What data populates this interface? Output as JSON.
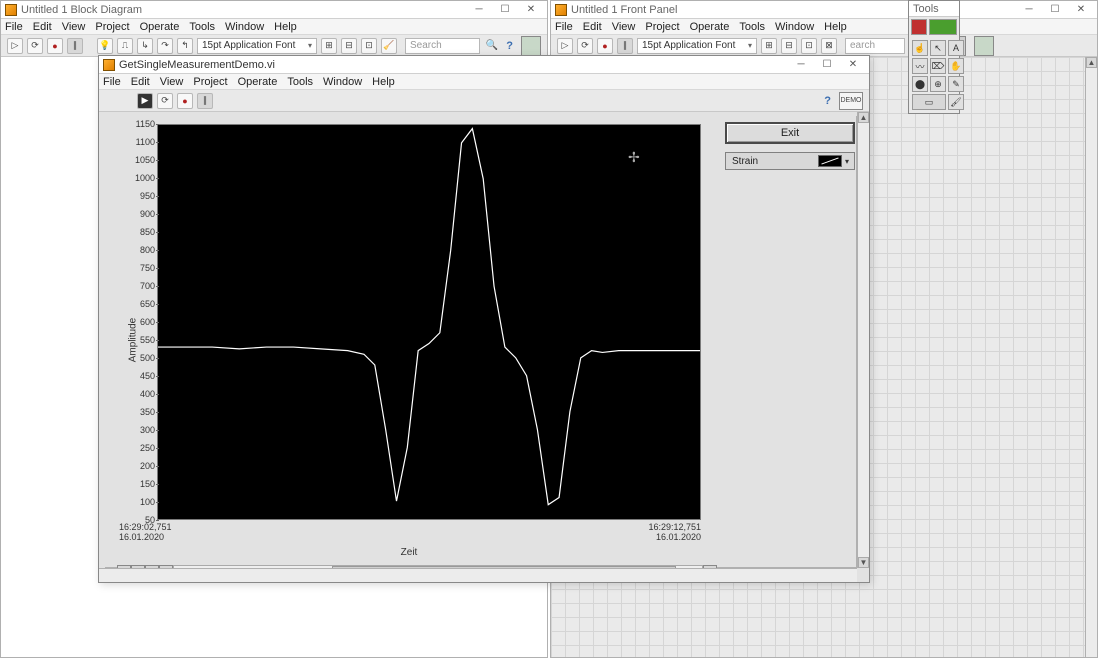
{
  "windows": {
    "block_diagram": {
      "title": "Untitled 1 Block Diagram",
      "menu": [
        "File",
        "Edit",
        "View",
        "Project",
        "Operate",
        "Tools",
        "Window",
        "Help"
      ],
      "font": "15pt Application Font",
      "search_placeholder": "Search"
    },
    "front_panel": {
      "title": "Untitled 1 Front Panel",
      "menu": [
        "File",
        "Edit",
        "View",
        "Project",
        "Operate",
        "Tools",
        "Window",
        "Help"
      ],
      "font": "15pt Application Font",
      "search_placeholder": "earch"
    },
    "tools": {
      "title": "Tools"
    },
    "demo": {
      "title": "GetSingleMeasurementDemo.vi",
      "menu": [
        "File",
        "Edit",
        "View",
        "Project",
        "Operate",
        "Tools",
        "Window",
        "Help"
      ],
      "corner_label": "DEMO"
    }
  },
  "controls": {
    "exit_label": "Exit",
    "legend_name": "Strain"
  },
  "chart_data": {
    "type": "line",
    "xlabel": "Zeit",
    "ylabel": "Amplitude",
    "ylim": [
      50,
      1150
    ],
    "y_ticks": [
      50,
      100,
      150,
      200,
      250,
      300,
      350,
      400,
      450,
      500,
      550,
      600,
      650,
      700,
      750,
      800,
      850,
      900,
      950,
      1000,
      1050,
      1100,
      1150
    ],
    "x_start_time": "16:29:02,751",
    "x_start_date": "16.01.2020",
    "x_end_time": "16:29:12,751",
    "x_end_date": "16.01.2020",
    "series": [
      {
        "name": "Strain",
        "color": "#ffffff",
        "x_fraction": [
          0.0,
          0.05,
          0.1,
          0.15,
          0.2,
          0.25,
          0.3,
          0.35,
          0.38,
          0.4,
          0.42,
          0.44,
          0.46,
          0.48,
          0.5,
          0.52,
          0.54,
          0.56,
          0.58,
          0.6,
          0.62,
          0.64,
          0.66,
          0.68,
          0.7,
          0.72,
          0.74,
          0.76,
          0.78,
          0.8,
          0.82,
          0.85,
          0.9,
          0.95,
          1.0
        ],
        "y": [
          530,
          530,
          530,
          525,
          530,
          530,
          525,
          520,
          510,
          480,
          300,
          100,
          250,
          520,
          540,
          570,
          800,
          1100,
          1140,
          1000,
          700,
          530,
          500,
          450,
          300,
          90,
          110,
          350,
          500,
          520,
          515,
          520,
          520,
          520,
          520
        ]
      }
    ]
  }
}
